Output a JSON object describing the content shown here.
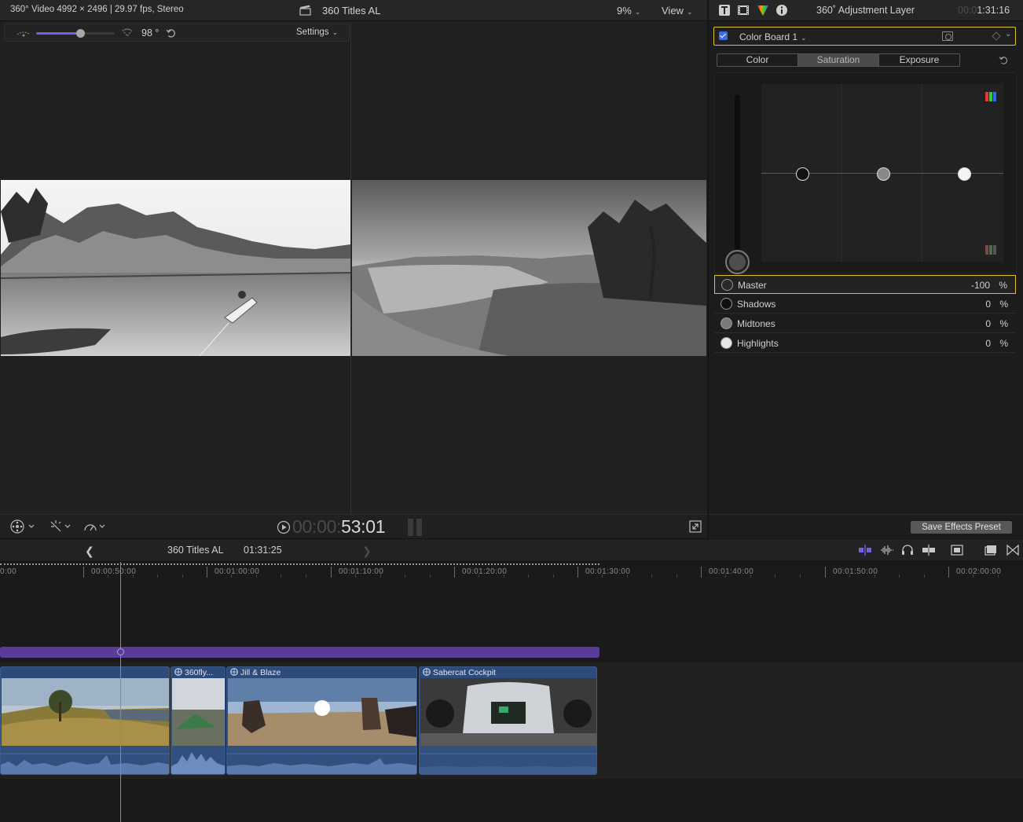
{
  "viewer": {
    "info": "360° Video 4992 × 2496 | 29.97 fps, Stereo",
    "project_title": "360 Titles AL",
    "zoom_level": "9%",
    "view_menu": "View",
    "fov_value": "98 °",
    "fov_fraction": 0.56,
    "settings_menu": "Settings",
    "timecode_dim": "00:00:",
    "timecode_bright": "53:01"
  },
  "inspector": {
    "title": "360˚ Adjustment Layer",
    "duration_dim": "00:0",
    "duration_bright": "1:31:16",
    "effect_name": "Color Board 1",
    "tabs": [
      "Color",
      "Saturation",
      "Exposure"
    ],
    "active_tab": "Saturation",
    "params": [
      {
        "label": "Master",
        "value": "-100",
        "unit": "%",
        "selected": true,
        "swatch": "#2a2a2a"
      },
      {
        "label": "Shadows",
        "value": "0",
        "unit": "%",
        "selected": false,
        "swatch": "#0f0f0f"
      },
      {
        "label": "Midtones",
        "value": "0",
        "unit": "%",
        "selected": false,
        "swatch": "#7a7a7a"
      },
      {
        "label": "Highlights",
        "value": "0",
        "unit": "%",
        "selected": false,
        "swatch": "#e6e6e6"
      }
    ],
    "save_preset": "Save Effects Preset"
  },
  "timeline": {
    "project_title": "360 Titles AL",
    "duration": "01:31:25",
    "ruler_labels": [
      "0:00",
      "00:00:50:00",
      "00:01:00:00",
      "00:01:10:00",
      "00:01:20:00",
      "00:01:30:00",
      "00:01:40:00",
      "00:01:50:00",
      "00:02:00:00"
    ],
    "clips": [
      {
        "title": ""
      },
      {
        "title": "360fly..."
      },
      {
        "title": "Jill & Blaze"
      },
      {
        "title": "Sabercat Cockpit"
      }
    ]
  },
  "colors": {
    "accent_yellow": "#e0c22a",
    "adjustment_layer": "#5b3b9a",
    "clip_blue": "#2d4a78",
    "slider_blue": "#6e63e0"
  }
}
